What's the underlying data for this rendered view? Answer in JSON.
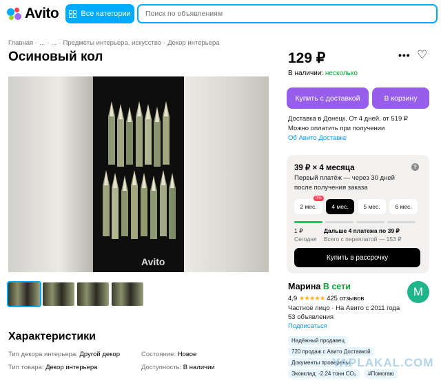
{
  "header": {
    "logo_text": "Avito",
    "categories_label": "Все категории",
    "search_placeholder": "Поиск по объявлениям"
  },
  "breadcrumbs": [
    "Главная",
    "·",
    "...",
    "·",
    "...",
    "·",
    "Предметы интерьера, искусство",
    "·",
    "Декор интерьера"
  ],
  "listing": {
    "title": "Осиновый кол",
    "price": "129 ₽",
    "stock_label": "В наличии:",
    "stock_value": "несколько",
    "watermark": "Avito"
  },
  "actions": {
    "buy_delivery": "Купить с доставкой",
    "to_cart": "В корзину"
  },
  "delivery": {
    "line1": "Доставка в Донецк. От 4 дней, от 519 ₽",
    "line2": "Можно оплатить при получении",
    "link": "Об Авито Доставке"
  },
  "installment": {
    "title": "39 ₽ × 4 месяца",
    "help": "?",
    "desc1": "Первый платёж — через 30 дней",
    "desc2": "после получения заказа",
    "zero_badge": "0%",
    "months": [
      "2 мес.",
      "4 мес.",
      "5 мес.",
      "6 мес."
    ],
    "selected_month_index": 1,
    "progress_filled": 1,
    "progress_total": 4,
    "pay1_amount": "1 ₽",
    "pay1_when": "Сегодня",
    "pay2_amount": "Дальше 4 платежа по 39 ₽",
    "pay2_total": "Всего с переплатой — 153 ₽",
    "button": "Купить в рассрочку"
  },
  "seller": {
    "name": "Марина",
    "online": "В сети",
    "avatar_letter": "М",
    "rating": "4,9",
    "stars": "★★★★★",
    "reviews": "425 отзывов",
    "type": "Частное лицо · На Авито с 2011 года",
    "ads": "53 объявления",
    "subscribe": "Подписаться",
    "tags": [
      "Надёжный продавец",
      "720 продаж с Авито Доставкой",
      "Документы проверены",
      "Экокклад: -2.24 тонн CO₂",
      "#Помогаю"
    ]
  },
  "characteristics": {
    "title": "Характеристики",
    "rows": [
      {
        "k": "Тип декора интерьера:",
        "v": "Другой декор"
      },
      {
        "k": "Тип товара:",
        "v": "Декор интерьера"
      },
      {
        "k": "Состояние:",
        "v": "Новое"
      },
      {
        "k": "Доступность:",
        "v": "В наличии"
      }
    ]
  },
  "site_watermark": "YAPLAKAL.COM",
  "colors": {
    "brand_blue": "#00aaff",
    "purple": "#965eeb",
    "green": "#02a734"
  },
  "icons": [
    "search-icon",
    "grid-icon",
    "more-icon",
    "heart-icon",
    "help-icon",
    "star-icon"
  ]
}
